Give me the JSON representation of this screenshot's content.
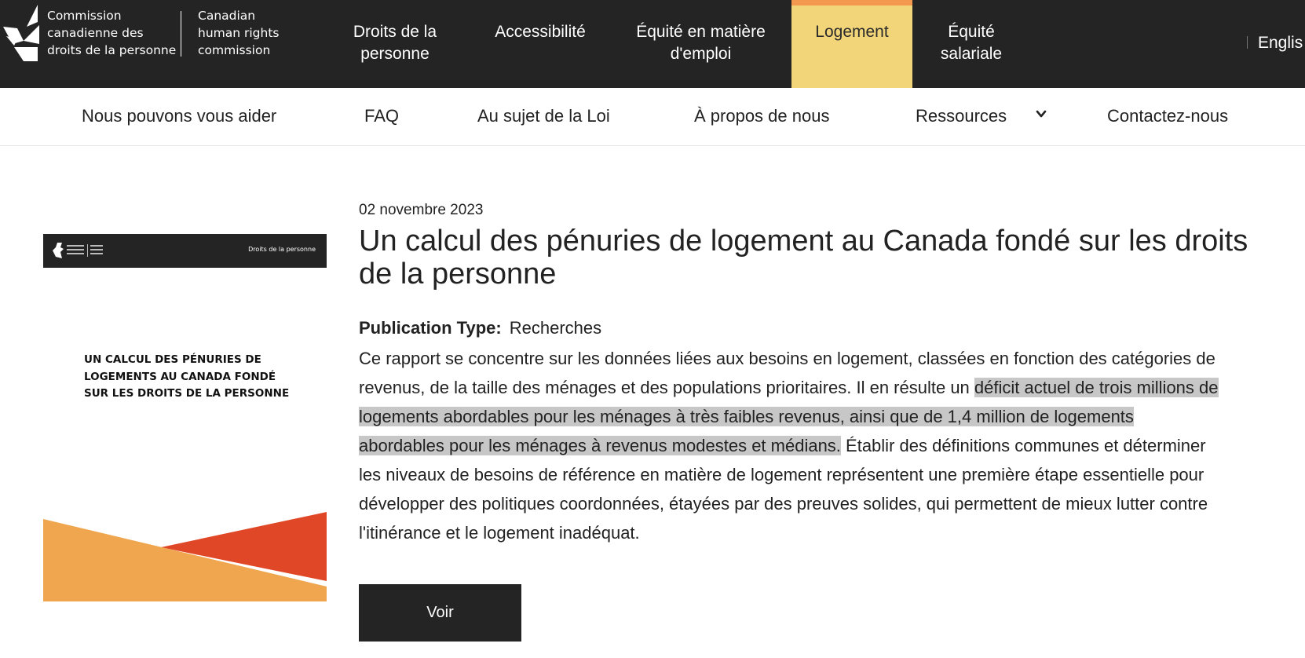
{
  "header": {
    "logo_fr": [
      "Commission",
      "canadienne des",
      "droits de la personne"
    ],
    "logo_en": [
      "Canadian",
      "human rights",
      "commission"
    ],
    "nav": [
      {
        "lines": [
          "Droits de la",
          "personne"
        ]
      },
      {
        "lines": [
          "Accessibilité"
        ]
      },
      {
        "lines": [
          "Équité en matière",
          "d'emploi"
        ]
      },
      {
        "lines": [
          "Logement"
        ]
      },
      {
        "lines": [
          "Équité",
          "salariale"
        ]
      }
    ],
    "active_nav": "Logement",
    "language_link": "Englis"
  },
  "subnav": {
    "items": [
      "Nous pouvons vous aider",
      "FAQ",
      "Au sujet de la Loi",
      "À propos de nous",
      "Ressources",
      "Contactez-nous"
    ]
  },
  "cover": {
    "bar_label": "Droits de la personne",
    "title_lines": [
      "UN CALCUL DES PÉNURIES DE",
      "LOGEMENTS AU CANADA FONDÉ",
      "SUR LES DROITS DE LA PERSONNE"
    ]
  },
  "article": {
    "date": "02 novembre 2023",
    "title_lines": [
      "Un calcul des pénuries de logement au Canada fondé sur les droits",
      "de la personne"
    ],
    "publication_type_label": "Publication Type:",
    "publication_type_value": "Recherches",
    "description": {
      "l1": "Ce rapport se concentre sur les données liées aux besoins en logement, classées en fonction des catégories de",
      "l2_plain": "revenus, de la taille des ménages et des populations prioritaires. Il en résulte un ",
      "l2_hl": "déficit actuel de trois millions de",
      "l3_hl": "logements abordables pour les ménages à très faibles revenus, ainsi que de 1,4 million de logements",
      "l4_hl": "abordables pour les ménages à revenus modestes et médians.",
      "l4_plain": " Établir des définitions communes et déterminer",
      "l5": "les niveaux de besoins de référence en matière de logement représentent une première étape essentielle pour",
      "l6": "développer des politiques coordonnées, étayées par des preuves solides, qui permettent de mieux lutter contre",
      "l7": "l'itinérance et le logement inadéquat."
    },
    "button_label": "Voir"
  },
  "colors": {
    "header_bg": "#242424",
    "active_nav_bg": "#f2d579",
    "active_nav_accent": "#f4984f",
    "highlight": "#c7c7c7",
    "cover_orange": "#f0a64e",
    "cover_red": "#e04726"
  }
}
